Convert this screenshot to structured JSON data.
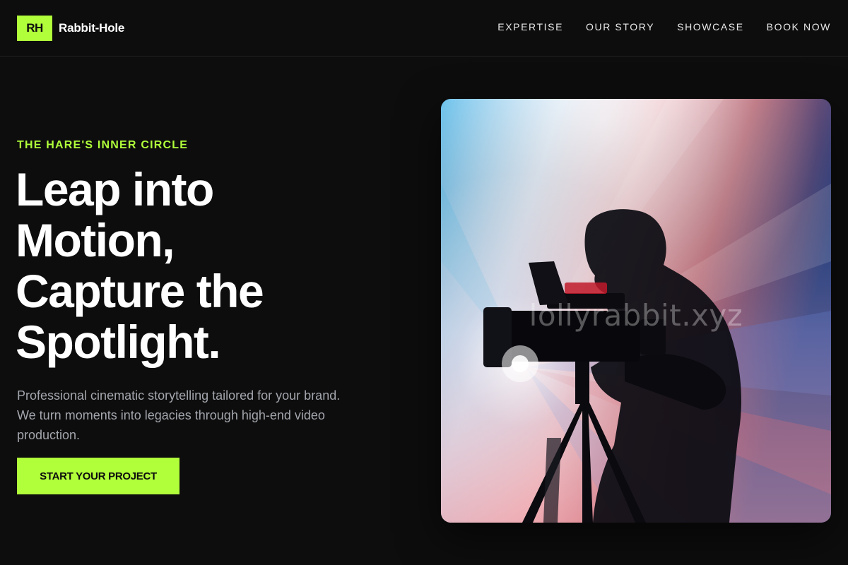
{
  "header": {
    "logo_badge": "RH",
    "brand_name": "Rabbit-Hole",
    "nav": [
      {
        "label": "EXPERTISE"
      },
      {
        "label": "OUR STORY"
      },
      {
        "label": "SHOWCASE"
      },
      {
        "label": "BOOK NOW"
      }
    ]
  },
  "hero": {
    "eyebrow": "THE HARE'S INNER CIRCLE",
    "headline_lines": [
      "Leap into",
      "Motion,",
      "Capture the",
      "Spotlight."
    ],
    "subtext": "Professional cinematic storytelling tailored for your brand. We turn moments into legacies through high-end video production.",
    "cta_label": "START YOUR PROJECT",
    "image": {
      "subject": "videographer-with-camera-silhouette",
      "watermark": "lollyrabbit.xyz"
    }
  },
  "colors": {
    "background": "#0d0d0d",
    "accent": "#b0ff3a",
    "text": "#ffffff",
    "muted_text": "#a3a6ad",
    "divider": "#222222"
  }
}
